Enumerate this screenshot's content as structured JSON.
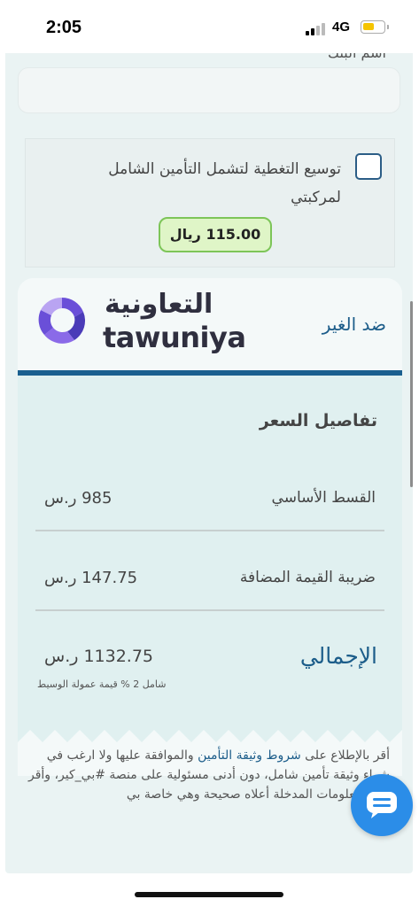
{
  "status_bar": {
    "time": "2:05",
    "network": "4G",
    "battery_level": 0.55
  },
  "bank_field": {
    "label": "اسم البنك",
    "value": ""
  },
  "coverage_extension": {
    "checked": false,
    "text": "توسيع التغطية لتشمل التأمين الشامل لمركبتي",
    "price": "115.00 ريال"
  },
  "insurance_card": {
    "coverage_type": "ضد الغير",
    "provider_logo_ar": "التعاونية",
    "provider_logo_en": "tawuniya",
    "price_details": {
      "title": "تفاصيل السعر",
      "rows": [
        {
          "label": "القسط الأساسي",
          "value": "985 ر.س"
        },
        {
          "label": "ضريبة القيمة المضافة",
          "value": "147.75 ر.س"
        }
      ],
      "total_label": "الإجمالي",
      "total_value": "1132.75 ر.س",
      "commission_note": "شامل 2 % قيمة عمولة الوسيط"
    }
  },
  "terms": {
    "prefix": "أقر بالإطلاع على ",
    "link_text": "شروط وثيقة التأمين",
    "suffix": " والموافقة عليها ولا ارغب في شراء وثيقة تأمين شامل، دون أدنى مسئولية على منصة #بي_كير، وأقر بأن المعلومات المدخلة أعلاه صحيحة وهي خاصة بي"
  },
  "colors": {
    "accent": "#1c5d8a",
    "success": "#7dc558",
    "chat": "#2b8de8",
    "logo_purple": "#6a4fd8"
  },
  "icons": {
    "chat": "chat-bubble-icon",
    "checkbox": "checkbox-icon"
  }
}
